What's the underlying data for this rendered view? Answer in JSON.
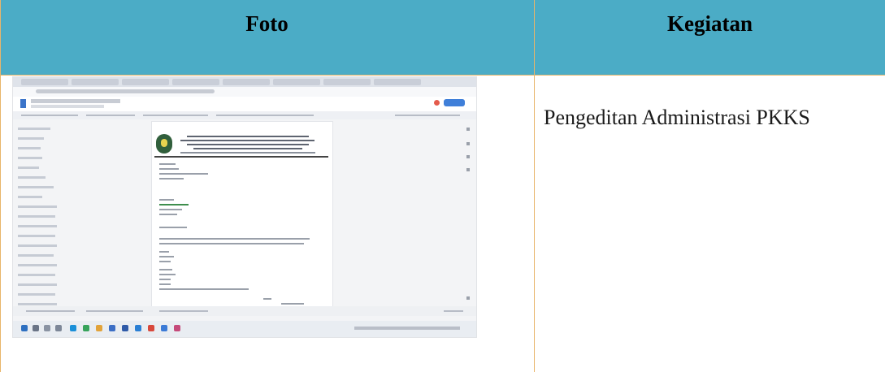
{
  "table": {
    "headers": {
      "foto": "Foto",
      "kegiatan": "Kegiatan"
    },
    "rows": [
      {
        "kegiatan": "Pengeditan Administrasi PKKS"
      }
    ]
  },
  "colors": {
    "header_bg": "#4bacc6",
    "border": "#e8b56a",
    "doc_accent": "#3f7fd9"
  }
}
